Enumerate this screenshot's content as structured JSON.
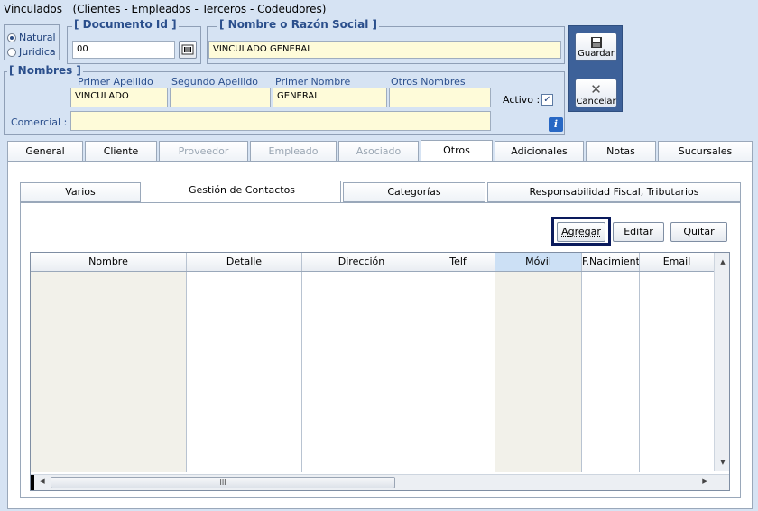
{
  "window": {
    "title": "Vinculados",
    "subtitle": "(Clientes - Empleados - Terceros - Codeudores)"
  },
  "person_type": {
    "options": [
      "Natural",
      "Juridica"
    ],
    "selected": "Natural"
  },
  "documento": {
    "legend": "[ Documento Id ]",
    "value": "00"
  },
  "razon_social": {
    "legend": "[ Nombre o Razón Social ]",
    "value": "VINCULADO GENERAL"
  },
  "nombres": {
    "legend": "[ Nombres ]",
    "primer_apellido_label": "Primer Apellido",
    "primer_apellido": "VINCULADO",
    "segundo_apellido_label": "Segundo Apellido",
    "segundo_apellido": "",
    "primer_nombre_label": "Primer Nombre",
    "primer_nombre": "GENERAL",
    "otros_nombres_label": "Otros Nombres",
    "otros_nombres": "",
    "activo_label": "Activo :",
    "activo_checked": true,
    "comercial_label": "Comercial :",
    "comercial": ""
  },
  "actions": {
    "guardar": "Guardar",
    "cancelar": "Cancelar"
  },
  "main_tabs": [
    {
      "label": "General",
      "state": "normal"
    },
    {
      "label": "Cliente",
      "state": "normal"
    },
    {
      "label": "Proveedor",
      "state": "disabled"
    },
    {
      "label": "Empleado",
      "state": "disabled"
    },
    {
      "label": "Asociado",
      "state": "disabled"
    },
    {
      "label": "Otros",
      "state": "active"
    },
    {
      "label": "Adicionales",
      "state": "normal"
    },
    {
      "label": "Notas",
      "state": "normal"
    },
    {
      "label": "Sucursales",
      "state": "normal"
    }
  ],
  "sub_tabs": [
    {
      "label": "Varios",
      "state": "normal"
    },
    {
      "label": "Gestión de Contactos",
      "state": "active"
    },
    {
      "label": "Categorías",
      "state": "normal"
    },
    {
      "label": "Responsabilidad Fiscal, Tributarios",
      "state": "normal"
    }
  ],
  "contact_buttons": {
    "agregar": "Agregar",
    "editar": "Editar",
    "quitar": "Quitar"
  },
  "grid": {
    "columns": [
      "Nombre",
      "Detalle",
      "Dirección",
      "Telf",
      "Móvil",
      "F.Nacimiento",
      "Email"
    ],
    "selected_column": "Móvil",
    "rows": []
  },
  "scroll": {
    "thumb_glyph": "III"
  },
  "colors": {
    "background": "#d6e3f3",
    "legend_text": "#2b4f8c",
    "field_fill": "#fefbd9",
    "side_panel": "#3d6199",
    "focus_border": "#0a1a5c"
  },
  "icons": {
    "barcode": "barcode-icon",
    "save": "floppy-disk-icon",
    "cancel": "x-icon",
    "info": "info-icon"
  }
}
